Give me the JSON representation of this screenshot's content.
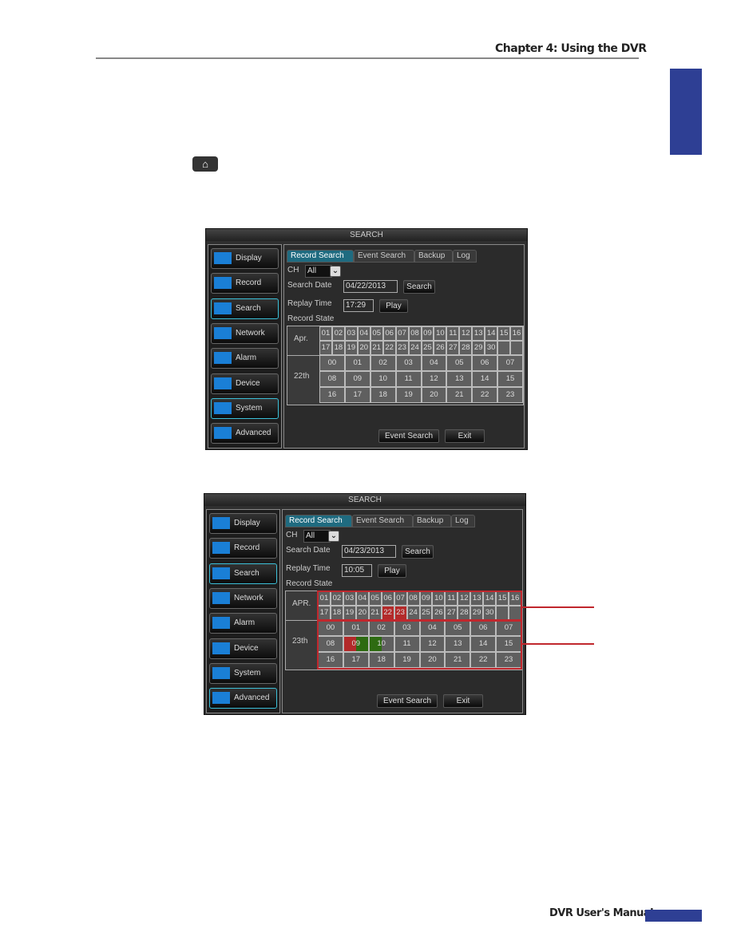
{
  "header": {
    "chapter": "Chapter 4: Using the DVR"
  },
  "footer": {
    "manual": "DVR User's Manual"
  },
  "colors": {
    "brand": "#2e3f94",
    "record_red": "#b32a2a",
    "record_green": "#2e6b12",
    "annotation": "#c0272d",
    "selected_border": "#3cc0d8"
  },
  "icons": {
    "inline": "home-icon"
  },
  "screens": [
    {
      "title": "SEARCH",
      "menu": [
        "Display",
        "Record",
        "Search",
        "Network",
        "Alarm",
        "Device",
        "System",
        "Advanced"
      ],
      "menu_highlight": [
        "Search",
        "System"
      ],
      "tabs": [
        "Record Search",
        "Event Search",
        "Backup",
        "Log"
      ],
      "ch_label": "CH",
      "ch_value": "All",
      "date_label": "Search Date",
      "date_value": "04/22/2013",
      "search_btn": "Search",
      "time_label": "Replay Time",
      "time_value": "17:29",
      "play_btn": "Play",
      "state_label": "Record State",
      "month": "Apr.",
      "day": "22th",
      "red_days": [],
      "hour_states": {},
      "event_btn": "Event Search",
      "exit_btn": "Exit",
      "annotated": false
    },
    {
      "title": "SEARCH",
      "menu": [
        "Display",
        "Record",
        "Search",
        "Network",
        "Alarm",
        "Device",
        "System",
        "Advanced"
      ],
      "menu_highlight": [
        "Search",
        "Advanced"
      ],
      "tabs": [
        "Record Search",
        "Event Search",
        "Backup",
        "Log"
      ],
      "ch_label": "CH",
      "ch_value": "All",
      "date_label": "Search Date",
      "date_value": "04/23/2013",
      "search_btn": "Search",
      "time_label": "Replay Time",
      "time_value": "10:05",
      "play_btn": "Play",
      "state_label": "Record State",
      "month": "APR.",
      "day": "23th",
      "red_days": [
        "22",
        "23"
      ],
      "hour_states": {
        "09": "red-green",
        "10": "green-partial"
      },
      "event_btn": "Event Search",
      "exit_btn": "Exit",
      "annotated": true
    }
  ]
}
